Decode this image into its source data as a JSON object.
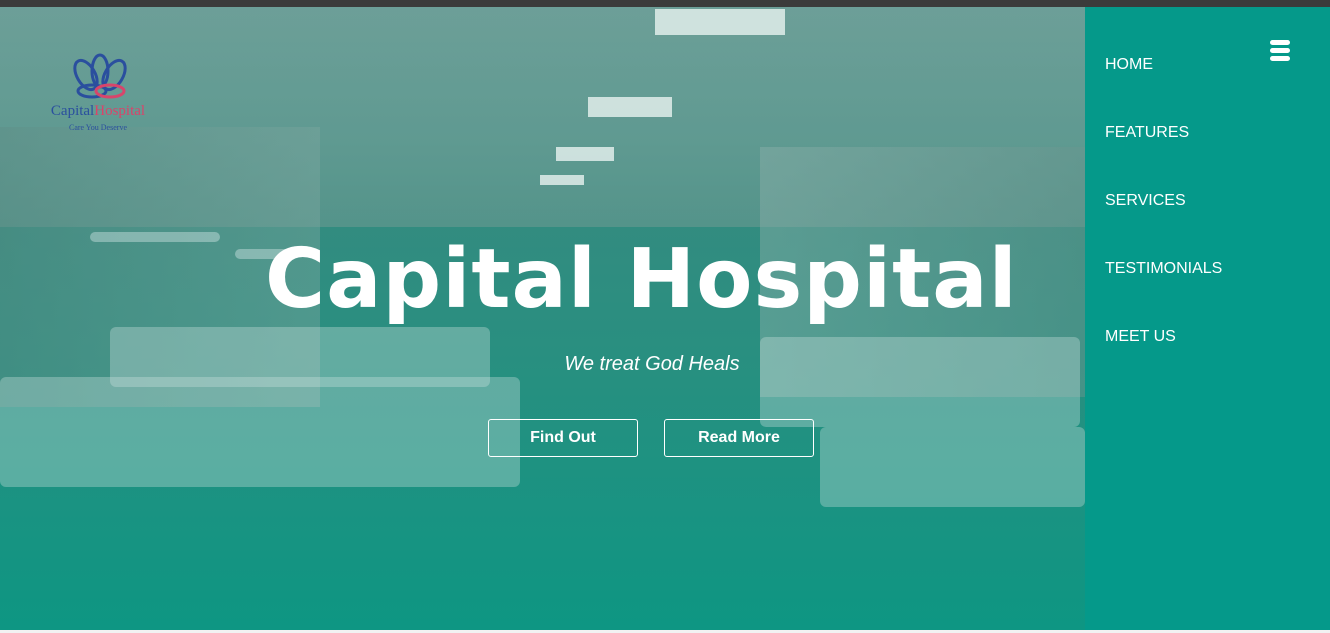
{
  "hero": {
    "title": "Capital Hospital",
    "subtitle": "We treat God Heals",
    "buttons": {
      "find_out": "Find Out",
      "read_more": "Read More"
    }
  },
  "logo": {
    "name_part1": "Capital",
    "name_part2": "Hospital",
    "tagline": "Care You Deserve"
  },
  "nav": {
    "items": [
      {
        "label": "HOME"
      },
      {
        "label": "FEATURES"
      },
      {
        "label": "SERVICES"
      },
      {
        "label": "TESTIMONIALS"
      },
      {
        "label": "MEET US"
      }
    ],
    "menu_icon": "hamburger-menu-icon"
  },
  "colors": {
    "sidebar": "#05998a",
    "hero_overlay": "#0e9682",
    "logo_blue": "#2a4f9e",
    "logo_pink": "#d8456b",
    "text": "#ffffff"
  }
}
